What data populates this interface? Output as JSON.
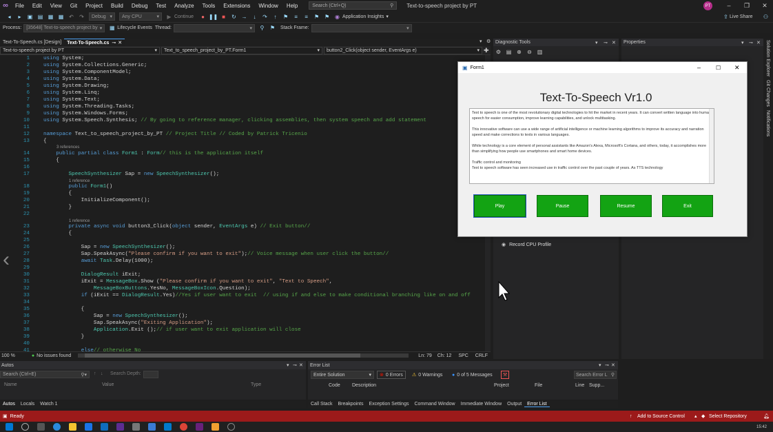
{
  "menu": [
    "File",
    "Edit",
    "View",
    "Git",
    "Project",
    "Build",
    "Debug",
    "Test",
    "Analyze",
    "Tools",
    "Extensions",
    "Window",
    "Help"
  ],
  "search_placeholder": "Search (Ctrl+Q)",
  "window_title": "Text-to-speech project by PT",
  "avatar_initials": "PT",
  "toolbar": {
    "config": "Debug",
    "platform": "Any CPU",
    "continue": "Continue",
    "app_insights": "Application Insights",
    "live_share": "Live Share"
  },
  "process_bar": {
    "process_label": "Process:",
    "process_value": "[35648] Text-to-speech project by",
    "lifecycle": "Lifecycle Events",
    "thread": "Thread:",
    "stack_frame": "Stack Frame:"
  },
  "doc_tabs": [
    "Text-To-Speech.cs [Design]",
    "Text-To-Speech.cs"
  ],
  "nav": {
    "project": "Text-to-speech project by PT",
    "class": "Text_to_speech_project_by_PT.Form1",
    "member": "button2_Click(object sender, EventArgs e)"
  },
  "editor_status": {
    "zoom": "100 %",
    "issues": "No issues found",
    "ln": "Ln: 79",
    "ch": "Ch: 12",
    "spc": "SPC",
    "crlf": "CRLF"
  },
  "diagnostic": {
    "title": "Diagnostic Tools",
    "record_cpu": "Record CPU Profile"
  },
  "properties_title": "Properties",
  "side_tabs": [
    "Solution Explorer",
    "Git Changes",
    "Notifications"
  ],
  "form": {
    "title": "Form1",
    "heading": "Text-To-Speech Vr1.0",
    "textbox": [
      "Text to speech is one of the most revolutionary digital technologies to hit the market in recent years. It can convert written language into human speech for easier consumption, improve learning capabilities, and unlock multitasking.",
      "This innovative software can use a wide range of artificial intelligence or machine learning algorithms to improve its accuracy and narration speed and make corrections to texts in various languages.",
      "While technology is a core element of personal assistants like Amazon's Alexa, Microsoft's Cortana, and others, today, it accomplishes more than simplifying how people use smartphones and smart home devices.",
      "Traffic control and monitoring",
      "Text to speech software has seen increased use in traffic control over the past couple of years. As TTS technology"
    ],
    "buttons": [
      "Play",
      "Pause",
      "Resume",
      "Exit"
    ]
  },
  "autos": {
    "title": "Autos",
    "search": "Search (Ctrl+E)",
    "search_depth": "Search Depth:",
    "cols": [
      "Name",
      "Value",
      "Type"
    ]
  },
  "error_list": {
    "title": "Error List",
    "scope": "Entire Solution",
    "errors": "0 Errors",
    "warnings": "0 Warnings",
    "messages": "0 of 5 Messages",
    "search": "Search Error L",
    "cols": [
      "Code",
      "Description",
      "Project",
      "File",
      "Line",
      "Supp..."
    ]
  },
  "bottom_tabs_left": [
    "Autos",
    "Locals",
    "Watch 1"
  ],
  "bottom_tabs_right": [
    "Call Stack",
    "Breakpoints",
    "Exception Settings",
    "Command Window",
    "Immediate Window",
    "Output",
    "Error List"
  ],
  "statusbar": {
    "ready": "Ready",
    "add_source": "Add to Source Control",
    "select_repo": "Select Repository"
  },
  "clock": "15:42",
  "code": [
    {
      "n": "1",
      "t": "using System;"
    },
    {
      "n": "2",
      "t": "using System.Collections.Generic;"
    },
    {
      "n": "3",
      "t": "using System.ComponentModel;"
    },
    {
      "n": "4",
      "t": "using System.Data;"
    },
    {
      "n": "5",
      "t": "using System.Drawing;"
    },
    {
      "n": "6",
      "t": "using System.Linq;"
    },
    {
      "n": "7",
      "t": "using System.Text;"
    },
    {
      "n": "8",
      "t": "using System.Threading.Tasks;"
    },
    {
      "n": "9",
      "t": "using System.Windows.Forms;"
    },
    {
      "n": "10",
      "t": "using System.Speech.Synthesis; // By going to reference manager, clicking assemblies, then system speech and add statement"
    },
    {
      "n": "11",
      "t": ""
    },
    {
      "n": "12",
      "t": "namespace Text_to_speech_project_by_PT // Project Title // Coded by Patrick Tricenio"
    },
    {
      "n": "13",
      "t": "{"
    },
    {
      "n": "14",
      "t": "    public partial class Form1 : Form// this is the application itself"
    },
    {
      "n": "15",
      "t": "    {"
    },
    {
      "n": "16",
      "t": ""
    },
    {
      "n": "17",
      "t": "        SpeechSynthesizer Sap = new SpeechSynthesizer();"
    },
    {
      "n": "18",
      "t": "        public Form1()"
    },
    {
      "n": "19",
      "t": "        {"
    },
    {
      "n": "20",
      "t": "            InitializeComponent();"
    },
    {
      "n": "21",
      "t": "        }"
    },
    {
      "n": "22",
      "t": ""
    },
    {
      "n": "23",
      "t": "        private async void button3_Click(object sender, EventArgs e) // Exit button//"
    },
    {
      "n": "24",
      "t": "        {"
    },
    {
      "n": "25",
      "t": ""
    },
    {
      "n": "26",
      "t": "            Sap = new SpeechSynthesizer();"
    },
    {
      "n": "27",
      "t": "            Sap.SpeakAsync(\"Please confirm if you want to exit\");// Voice message when user click the button//"
    },
    {
      "n": "28",
      "t": "            await Task.Delay(1000);"
    },
    {
      "n": "29",
      "t": ""
    },
    {
      "n": "30",
      "t": "            DialogResult iExit;"
    },
    {
      "n": "31",
      "t": "            iExit = MessageBox.Show (\"Please confirm if you want to exit\", \"Text to Speech\","
    },
    {
      "n": "32",
      "t": "                MessageBoxButtons.YesNo, MessageBoxIcon.Question);"
    },
    {
      "n": "33",
      "t": "            if (iExit == DialogResult.Yes)//Yes if user want to exit  // using if and else to make conditional branching like on and off"
    },
    {
      "n": "34",
      "t": ""
    },
    {
      "n": "35",
      "t": "            {"
    },
    {
      "n": "36",
      "t": "                Sap = new SpeechSynthesizer();"
    },
    {
      "n": "37",
      "t": "                Sap.SpeakAsync(\"Exiting Application\");"
    },
    {
      "n": "38",
      "t": "                Application.Exit ();// if user want to exit application will close"
    },
    {
      "n": "39",
      "t": "            }"
    },
    {
      "n": "40",
      "t": ""
    },
    {
      "n": "41",
      "t": "            else// otherwise No"
    }
  ],
  "refs": [
    "3 references",
    "1 reference",
    "1 reference"
  ]
}
